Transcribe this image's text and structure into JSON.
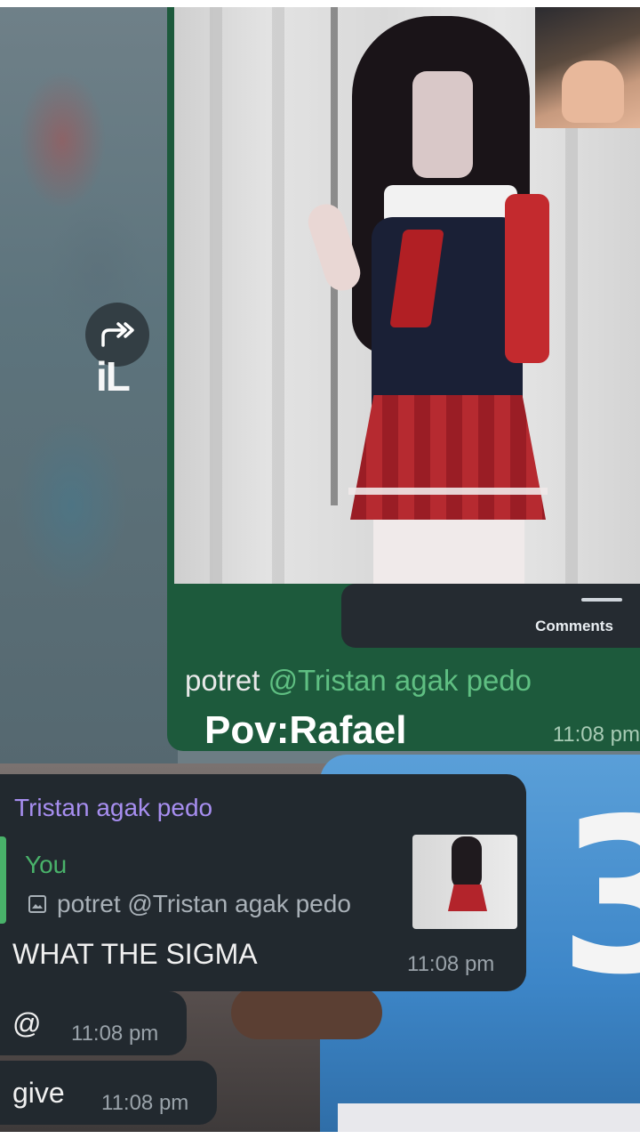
{
  "overlay_title": "Pov:Rafael",
  "watermark_text": "iL",
  "forwarded_post": {
    "comments_label": "Comments",
    "caption_prefix": "potret ",
    "caption_mention": "@Tristan agak pedo",
    "time": "11:08 pm"
  },
  "messages": [
    {
      "sender": "Tristan agak pedo",
      "reply_to": {
        "author": "You",
        "preview_text": "potret @Tristan agak pedo"
      },
      "text": "WHAT THE SIGMA",
      "time": "11:08 pm"
    },
    {
      "text": "@",
      "time": "11:08 pm"
    },
    {
      "text": "give",
      "time": "11:08 pm"
    }
  ],
  "colors": {
    "forward_bubble": "#1d5a3c",
    "incoming_bubble": "#22292f",
    "sender_name": "#a78ef0",
    "mention_and_quote_accent": "#49b26a",
    "jersey": "#3d86c8"
  },
  "icons": [
    "forward-icon",
    "image-icon"
  ],
  "background_jersey_number": "3"
}
